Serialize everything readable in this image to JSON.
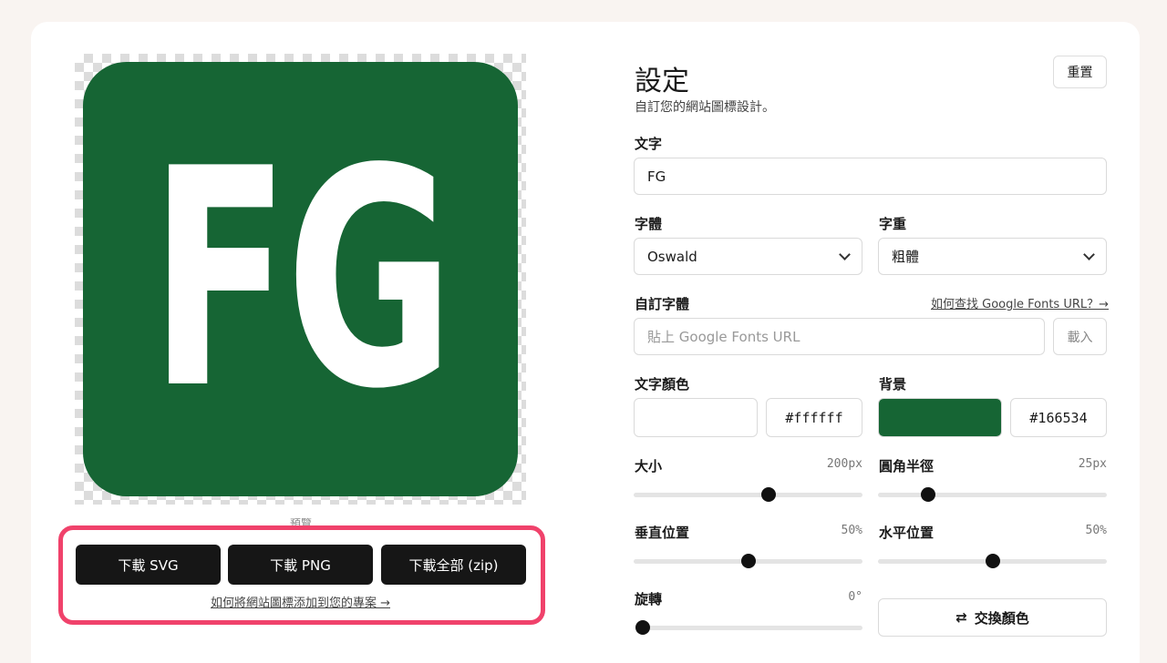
{
  "preview": {
    "favicon_text": "FG",
    "text_color": "#ffffff",
    "bg_color": "#166534",
    "label": "預覽"
  },
  "downloads": {
    "svg": "下載 SVG",
    "png": "下載 PNG",
    "zip": "下載全部 (zip)",
    "howto": "如何將網站圖標添加到您的專案 →"
  },
  "settings": {
    "title": "設定",
    "subtitle": "自訂您的網站圖標設計。",
    "reset": "重置",
    "text_label": "文字",
    "text_value": "FG",
    "font_label": "字體",
    "font_value": "Oswald",
    "weight_label": "字重",
    "weight_value": "粗體",
    "custom_font_label": "自訂字體",
    "custom_font_help": "如何查找 Google Fonts URL？→",
    "custom_font_placeholder": "貼上 Google Fonts URL",
    "load": "載入",
    "text_color_label": "文字顏色",
    "text_color_hex": "#ffffff",
    "bg_label": "背景",
    "bg_hex": "#166534",
    "size_label": "大小",
    "size_value": "200px",
    "radius_label": "圓角半徑",
    "radius_value": "25px",
    "vpos_label": "垂直位置",
    "vpos_value": "50%",
    "hpos_label": "水平位置",
    "hpos_value": "50%",
    "rotate_label": "旋轉",
    "rotate_value": "0°",
    "swap": "交換顏色"
  },
  "sliders": {
    "size": 0.59,
    "radius": 0.22,
    "vpos": 0.5,
    "hpos": 0.5,
    "rotate": 0.0
  }
}
